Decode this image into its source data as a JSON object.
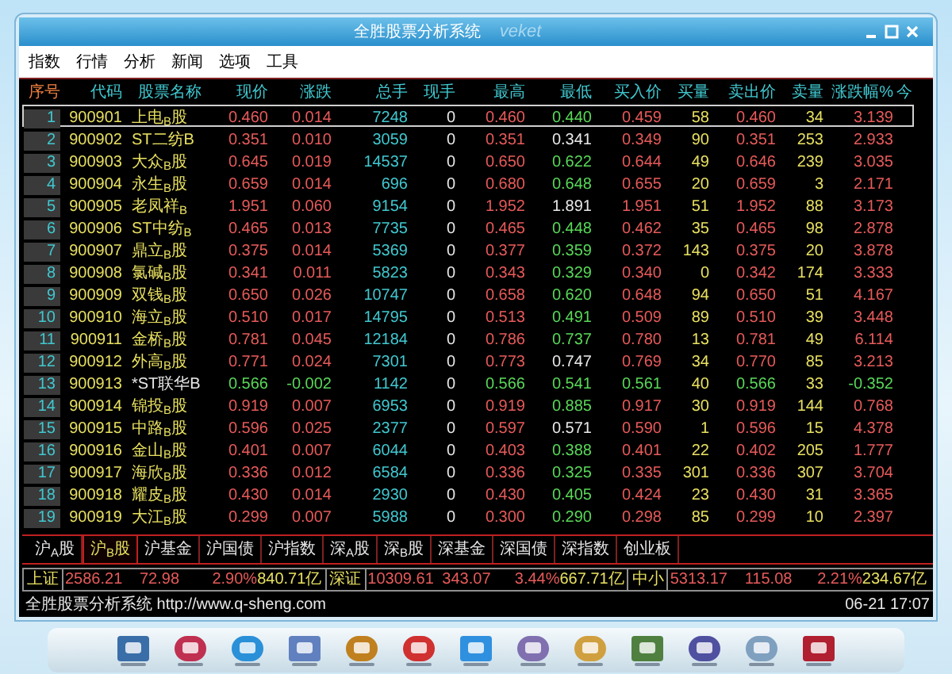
{
  "window": {
    "title": "全胜股票分析系统",
    "brand": "veket"
  },
  "menu": [
    "指数",
    "行情",
    "分析",
    "新闻",
    "选项",
    "工具"
  ],
  "table": {
    "columns": [
      {
        "label": "序号",
        "kind": "index"
      },
      {
        "label": "代码",
        "kind": "plain"
      },
      {
        "label": "股票名称",
        "kind": "plain"
      },
      {
        "label": "现价",
        "kind": "plain"
      },
      {
        "label": "涨跌",
        "kind": "plain"
      },
      {
        "label": "总手",
        "kind": "plain"
      },
      {
        "label": "现手",
        "kind": "plain"
      },
      {
        "label": "最高",
        "kind": "plain"
      },
      {
        "label": "最低",
        "kind": "plain"
      },
      {
        "label": "买入价",
        "kind": "plain"
      },
      {
        "label": "买量",
        "kind": "plain"
      },
      {
        "label": "卖出价",
        "kind": "plain"
      },
      {
        "label": "卖量",
        "kind": "plain"
      },
      {
        "label": "涨跌幅%",
        "kind": "plain"
      },
      {
        "label": "今",
        "kind": "plain"
      }
    ],
    "rows": [
      {
        "selected": true,
        "cells": [
          {
            "text": "1"
          },
          {
            "text": "900901",
            "color": "#e8e060"
          },
          {
            "text": "上电$_{B}$股",
            "color": "#e8e060"
          },
          {
            "text": "0.460",
            "color": "#e85a5a"
          },
          {
            "text": "0.014",
            "color": "#e85a5a"
          },
          {
            "text": "7248",
            "color": "#40c8d0"
          },
          {
            "text": "0",
            "color": "#e8e8e8"
          },
          {
            "text": "0.460",
            "color": "#e85a5a"
          },
          {
            "text": "0.440",
            "color": "#58d858"
          },
          {
            "text": "0.459",
            "color": "#e85a5a"
          },
          {
            "text": "58",
            "color": "#e8e060"
          },
          {
            "text": "0.460",
            "color": "#e85a5a"
          },
          {
            "text": "34",
            "color": "#e8e060"
          },
          {
            "text": "3.139",
            "color": "#e85a5a"
          }
        ]
      },
      {
        "selected": false,
        "cells": [
          {
            "text": "2"
          },
          {
            "text": "900902",
            "color": "#e8e060"
          },
          {
            "text": "ST二纺B",
            "color": "#e8e060"
          },
          {
            "text": "0.351",
            "color": "#e85a5a"
          },
          {
            "text": "0.010",
            "color": "#e85a5a"
          },
          {
            "text": "3059",
            "color": "#40c8d0"
          },
          {
            "text": "0",
            "color": "#e8e8e8"
          },
          {
            "text": "0.351",
            "color": "#e85a5a"
          },
          {
            "text": "0.341",
            "color": "#e8e8e8"
          },
          {
            "text": "0.349",
            "color": "#e85a5a"
          },
          {
            "text": "90",
            "color": "#e8e060"
          },
          {
            "text": "0.351",
            "color": "#e85a5a"
          },
          {
            "text": "253",
            "color": "#e8e060"
          },
          {
            "text": "2.933",
            "color": "#e85a5a"
          }
        ]
      },
      {
        "selected": false,
        "cells": [
          {
            "text": "3"
          },
          {
            "text": "900903",
            "color": "#e8e060"
          },
          {
            "text": "大众$_{B}$股",
            "color": "#e8e060"
          },
          {
            "text": "0.645",
            "color": "#e85a5a"
          },
          {
            "text": "0.019",
            "color": "#e85a5a"
          },
          {
            "text": "14537",
            "color": "#40c8d0"
          },
          {
            "text": "0",
            "color": "#e8e8e8"
          },
          {
            "text": "0.650",
            "color": "#e85a5a"
          },
          {
            "text": "0.622",
            "color": "#58d858"
          },
          {
            "text": "0.644",
            "color": "#e85a5a"
          },
          {
            "text": "49",
            "color": "#e8e060"
          },
          {
            "text": "0.646",
            "color": "#e85a5a"
          },
          {
            "text": "239",
            "color": "#e8e060"
          },
          {
            "text": "3.035",
            "color": "#e85a5a"
          }
        ]
      },
      {
        "selected": false,
        "cells": [
          {
            "text": "4"
          },
          {
            "text": "900904",
            "color": "#e8e060"
          },
          {
            "text": "永生$_{B}$股",
            "color": "#e8e060"
          },
          {
            "text": "0.659",
            "color": "#e85a5a"
          },
          {
            "text": "0.014",
            "color": "#e85a5a"
          },
          {
            "text": "696",
            "color": "#40c8d0"
          },
          {
            "text": "0",
            "color": "#e8e8e8"
          },
          {
            "text": "0.680",
            "color": "#e85a5a"
          },
          {
            "text": "0.648",
            "color": "#58d858"
          },
          {
            "text": "0.655",
            "color": "#e85a5a"
          },
          {
            "text": "20",
            "color": "#e8e060"
          },
          {
            "text": "0.659",
            "color": "#e85a5a"
          },
          {
            "text": "3",
            "color": "#e8e060"
          },
          {
            "text": "2.171",
            "color": "#e85a5a"
          }
        ]
      },
      {
        "selected": false,
        "cells": [
          {
            "text": "5"
          },
          {
            "text": "900905",
            "color": "#e8e060"
          },
          {
            "text": "老凤祥$_{B}$",
            "color": "#e8e060"
          },
          {
            "text": "1.951",
            "color": "#e85a5a"
          },
          {
            "text": "0.060",
            "color": "#e85a5a"
          },
          {
            "text": "9154",
            "color": "#40c8d0"
          },
          {
            "text": "0",
            "color": "#e8e8e8"
          },
          {
            "text": "1.952",
            "color": "#e85a5a"
          },
          {
            "text": "1.891",
            "color": "#e8e8e8"
          },
          {
            "text": "1.951",
            "color": "#e85a5a"
          },
          {
            "text": "51",
            "color": "#e8e060"
          },
          {
            "text": "1.952",
            "color": "#e85a5a"
          },
          {
            "text": "88",
            "color": "#e8e060"
          },
          {
            "text": "3.173",
            "color": "#e85a5a"
          }
        ]
      },
      {
        "selected": false,
        "cells": [
          {
            "text": "6"
          },
          {
            "text": "900906",
            "color": "#e8e060"
          },
          {
            "text": "ST中纺$_{B}$",
            "color": "#e8e060"
          },
          {
            "text": "0.465",
            "color": "#e85a5a"
          },
          {
            "text": "0.013",
            "color": "#e85a5a"
          },
          {
            "text": "7735",
            "color": "#40c8d0"
          },
          {
            "text": "0",
            "color": "#e8e8e8"
          },
          {
            "text": "0.465",
            "color": "#e85a5a"
          },
          {
            "text": "0.448",
            "color": "#58d858"
          },
          {
            "text": "0.462",
            "color": "#e85a5a"
          },
          {
            "text": "35",
            "color": "#e8e060"
          },
          {
            "text": "0.465",
            "color": "#e85a5a"
          },
          {
            "text": "98",
            "color": "#e8e060"
          },
          {
            "text": "2.878",
            "color": "#e85a5a"
          }
        ]
      },
      {
        "selected": false,
        "cells": [
          {
            "text": "7"
          },
          {
            "text": "900907",
            "color": "#e8e060"
          },
          {
            "text": "鼎立$_{B}$股",
            "color": "#e8e060"
          },
          {
            "text": "0.375",
            "color": "#e85a5a"
          },
          {
            "text": "0.014",
            "color": "#e85a5a"
          },
          {
            "text": "5369",
            "color": "#40c8d0"
          },
          {
            "text": "0",
            "color": "#e8e8e8"
          },
          {
            "text": "0.377",
            "color": "#e85a5a"
          },
          {
            "text": "0.359",
            "color": "#58d858"
          },
          {
            "text": "0.372",
            "color": "#e85a5a"
          },
          {
            "text": "143",
            "color": "#e8e060"
          },
          {
            "text": "0.375",
            "color": "#e85a5a"
          },
          {
            "text": "20",
            "color": "#e8e060"
          },
          {
            "text": "3.878",
            "color": "#e85a5a"
          }
        ]
      },
      {
        "selected": false,
        "cells": [
          {
            "text": "8"
          },
          {
            "text": "900908",
            "color": "#e8e060"
          },
          {
            "text": "氯碱$_{B}$股",
            "color": "#e8e060"
          },
          {
            "text": "0.341",
            "color": "#e85a5a"
          },
          {
            "text": "0.011",
            "color": "#e85a5a"
          },
          {
            "text": "5823",
            "color": "#40c8d0"
          },
          {
            "text": "0",
            "color": "#e8e8e8"
          },
          {
            "text": "0.343",
            "color": "#e85a5a"
          },
          {
            "text": "0.329",
            "color": "#58d858"
          },
          {
            "text": "0.340",
            "color": "#e85a5a"
          },
          {
            "text": "0",
            "color": "#e8e060"
          },
          {
            "text": "0.342",
            "color": "#e85a5a"
          },
          {
            "text": "174",
            "color": "#e8e060"
          },
          {
            "text": "3.333",
            "color": "#e85a5a"
          }
        ]
      },
      {
        "selected": false,
        "cells": [
          {
            "text": "9"
          },
          {
            "text": "900909",
            "color": "#e8e060"
          },
          {
            "text": "双钱$_{B}$股",
            "color": "#e8e060"
          },
          {
            "text": "0.650",
            "color": "#e85a5a"
          },
          {
            "text": "0.026",
            "color": "#e85a5a"
          },
          {
            "text": "10747",
            "color": "#40c8d0"
          },
          {
            "text": "0",
            "color": "#e8e8e8"
          },
          {
            "text": "0.658",
            "color": "#e85a5a"
          },
          {
            "text": "0.620",
            "color": "#58d858"
          },
          {
            "text": "0.648",
            "color": "#e85a5a"
          },
          {
            "text": "94",
            "color": "#e8e060"
          },
          {
            "text": "0.650",
            "color": "#e85a5a"
          },
          {
            "text": "51",
            "color": "#e8e060"
          },
          {
            "text": "4.167",
            "color": "#e85a5a"
          }
        ]
      },
      {
        "selected": false,
        "cells": [
          {
            "text": "10"
          },
          {
            "text": "900910",
            "color": "#e8e060"
          },
          {
            "text": "海立$_{B}$股",
            "color": "#e8e060"
          },
          {
            "text": "0.510",
            "color": "#e85a5a"
          },
          {
            "text": "0.017",
            "color": "#e85a5a"
          },
          {
            "text": "14795",
            "color": "#40c8d0"
          },
          {
            "text": "0",
            "color": "#e8e8e8"
          },
          {
            "text": "0.513",
            "color": "#e85a5a"
          },
          {
            "text": "0.491",
            "color": "#58d858"
          },
          {
            "text": "0.509",
            "color": "#e85a5a"
          },
          {
            "text": "89",
            "color": "#e8e060"
          },
          {
            "text": "0.510",
            "color": "#e85a5a"
          },
          {
            "text": "39",
            "color": "#e8e060"
          },
          {
            "text": "3.448",
            "color": "#e85a5a"
          }
        ]
      },
      {
        "selected": false,
        "cells": [
          {
            "text": "11"
          },
          {
            "text": "900911",
            "color": "#e8e060"
          },
          {
            "text": "金桥$_{B}$股",
            "color": "#e8e060"
          },
          {
            "text": "0.781",
            "color": "#e85a5a"
          },
          {
            "text": "0.045",
            "color": "#e85a5a"
          },
          {
            "text": "12184",
            "color": "#40c8d0"
          },
          {
            "text": "0",
            "color": "#e8e8e8"
          },
          {
            "text": "0.786",
            "color": "#e85a5a"
          },
          {
            "text": "0.737",
            "color": "#58d858"
          },
          {
            "text": "0.780",
            "color": "#e85a5a"
          },
          {
            "text": "13",
            "color": "#e8e060"
          },
          {
            "text": "0.781",
            "color": "#e85a5a"
          },
          {
            "text": "49",
            "color": "#e8e060"
          },
          {
            "text": "6.114",
            "color": "#e85a5a"
          }
        ]
      },
      {
        "selected": false,
        "cells": [
          {
            "text": "12"
          },
          {
            "text": "900912",
            "color": "#e8e060"
          },
          {
            "text": "外高$_{B}$股",
            "color": "#e8e060"
          },
          {
            "text": "0.771",
            "color": "#e85a5a"
          },
          {
            "text": "0.024",
            "color": "#e85a5a"
          },
          {
            "text": "7301",
            "color": "#40c8d0"
          },
          {
            "text": "0",
            "color": "#e8e8e8"
          },
          {
            "text": "0.773",
            "color": "#e85a5a"
          },
          {
            "text": "0.747",
            "color": "#e8e8e8"
          },
          {
            "text": "0.769",
            "color": "#e85a5a"
          },
          {
            "text": "34",
            "color": "#e8e060"
          },
          {
            "text": "0.770",
            "color": "#e85a5a"
          },
          {
            "text": "85",
            "color": "#e8e060"
          },
          {
            "text": "3.213",
            "color": "#e85a5a"
          }
        ]
      },
      {
        "selected": false,
        "cells": [
          {
            "text": "13"
          },
          {
            "text": "900913",
            "color": "#e8e060"
          },
          {
            "text": "*ST联华B",
            "color": "#e8e8e8"
          },
          {
            "text": "0.566",
            "color": "#58d858"
          },
          {
            "text": "-0.002",
            "color": "#58d858"
          },
          {
            "text": "1142",
            "color": "#40c8d0"
          },
          {
            "text": "0",
            "color": "#e8e8e8"
          },
          {
            "text": "0.566",
            "color": "#58d858"
          },
          {
            "text": "0.541",
            "color": "#58d858"
          },
          {
            "text": "0.561",
            "color": "#58d858"
          },
          {
            "text": "40",
            "color": "#e8e060"
          },
          {
            "text": "0.566",
            "color": "#58d858"
          },
          {
            "text": "33",
            "color": "#e8e060"
          },
          {
            "text": "-0.352",
            "color": "#58d858"
          }
        ]
      },
      {
        "selected": false,
        "cells": [
          {
            "text": "14"
          },
          {
            "text": "900914",
            "color": "#e8e060"
          },
          {
            "text": "锦投$_{B}$股",
            "color": "#e8e060"
          },
          {
            "text": "0.919",
            "color": "#e85a5a"
          },
          {
            "text": "0.007",
            "color": "#e85a5a"
          },
          {
            "text": "6953",
            "color": "#40c8d0"
          },
          {
            "text": "0",
            "color": "#e8e8e8"
          },
          {
            "text": "0.919",
            "color": "#e85a5a"
          },
          {
            "text": "0.885",
            "color": "#58d858"
          },
          {
            "text": "0.917",
            "color": "#e85a5a"
          },
          {
            "text": "30",
            "color": "#e8e060"
          },
          {
            "text": "0.919",
            "color": "#e85a5a"
          },
          {
            "text": "144",
            "color": "#e8e060"
          },
          {
            "text": "0.768",
            "color": "#e85a5a"
          }
        ]
      },
      {
        "selected": false,
        "cells": [
          {
            "text": "15"
          },
          {
            "text": "900915",
            "color": "#e8e060"
          },
          {
            "text": "中路$_{B}$股",
            "color": "#e8e060"
          },
          {
            "text": "0.596",
            "color": "#e85a5a"
          },
          {
            "text": "0.025",
            "color": "#e85a5a"
          },
          {
            "text": "2377",
            "color": "#40c8d0"
          },
          {
            "text": "0",
            "color": "#e8e8e8"
          },
          {
            "text": "0.597",
            "color": "#e85a5a"
          },
          {
            "text": "0.571",
            "color": "#e8e8e8"
          },
          {
            "text": "0.590",
            "color": "#e85a5a"
          },
          {
            "text": "1",
            "color": "#e8e060"
          },
          {
            "text": "0.596",
            "color": "#e85a5a"
          },
          {
            "text": "15",
            "color": "#e8e060"
          },
          {
            "text": "4.378",
            "color": "#e85a5a"
          }
        ]
      },
      {
        "selected": false,
        "cells": [
          {
            "text": "16"
          },
          {
            "text": "900916",
            "color": "#e8e060"
          },
          {
            "text": "金山$_{B}$股",
            "color": "#e8e060"
          },
          {
            "text": "0.401",
            "color": "#e85a5a"
          },
          {
            "text": "0.007",
            "color": "#e85a5a"
          },
          {
            "text": "6044",
            "color": "#40c8d0"
          },
          {
            "text": "0",
            "color": "#e8e8e8"
          },
          {
            "text": "0.403",
            "color": "#e85a5a"
          },
          {
            "text": "0.388",
            "color": "#58d858"
          },
          {
            "text": "0.401",
            "color": "#e85a5a"
          },
          {
            "text": "22",
            "color": "#e8e060"
          },
          {
            "text": "0.402",
            "color": "#e85a5a"
          },
          {
            "text": "205",
            "color": "#e8e060"
          },
          {
            "text": "1.777",
            "color": "#e85a5a"
          }
        ]
      },
      {
        "selected": false,
        "cells": [
          {
            "text": "17"
          },
          {
            "text": "900917",
            "color": "#e8e060"
          },
          {
            "text": "海欣$_{B}$股",
            "color": "#e8e060"
          },
          {
            "text": "0.336",
            "color": "#e85a5a"
          },
          {
            "text": "0.012",
            "color": "#e85a5a"
          },
          {
            "text": "6584",
            "color": "#40c8d0"
          },
          {
            "text": "0",
            "color": "#e8e8e8"
          },
          {
            "text": "0.336",
            "color": "#e85a5a"
          },
          {
            "text": "0.325",
            "color": "#58d858"
          },
          {
            "text": "0.335",
            "color": "#e85a5a"
          },
          {
            "text": "301",
            "color": "#e8e060"
          },
          {
            "text": "0.336",
            "color": "#e85a5a"
          },
          {
            "text": "307",
            "color": "#e8e060"
          },
          {
            "text": "3.704",
            "color": "#e85a5a"
          }
        ]
      },
      {
        "selected": false,
        "cells": [
          {
            "text": "18"
          },
          {
            "text": "900918",
            "color": "#e8e060"
          },
          {
            "text": "耀皮$_{B}$股",
            "color": "#e8e060"
          },
          {
            "text": "0.430",
            "color": "#e85a5a"
          },
          {
            "text": "0.014",
            "color": "#e85a5a"
          },
          {
            "text": "2930",
            "color": "#40c8d0"
          },
          {
            "text": "0",
            "color": "#e8e8e8"
          },
          {
            "text": "0.430",
            "color": "#e85a5a"
          },
          {
            "text": "0.405",
            "color": "#58d858"
          },
          {
            "text": "0.424",
            "color": "#e85a5a"
          },
          {
            "text": "23",
            "color": "#e8e060"
          },
          {
            "text": "0.430",
            "color": "#e85a5a"
          },
          {
            "text": "31",
            "color": "#e8e060"
          },
          {
            "text": "3.365",
            "color": "#e85a5a"
          }
        ]
      },
      {
        "selected": false,
        "cells": [
          {
            "text": "19"
          },
          {
            "text": "900919",
            "color": "#e8e060"
          },
          {
            "text": "大江$_{B}$股",
            "color": "#e8e060"
          },
          {
            "text": "0.299",
            "color": "#e85a5a"
          },
          {
            "text": "0.007",
            "color": "#e85a5a"
          },
          {
            "text": "5988",
            "color": "#40c8d0"
          },
          {
            "text": "0",
            "color": "#e8e8e8"
          },
          {
            "text": "0.300",
            "color": "#e85a5a"
          },
          {
            "text": "0.290",
            "color": "#58d858"
          },
          {
            "text": "0.298",
            "color": "#e85a5a"
          },
          {
            "text": "85",
            "color": "#e8e060"
          },
          {
            "text": "0.299",
            "color": "#e85a5a"
          },
          {
            "text": "10",
            "color": "#e8e060"
          },
          {
            "text": "2.397",
            "color": "#e85a5a"
          }
        ]
      }
    ]
  },
  "market_tabs": [
    {
      "label": "沪$_{A}$股",
      "selected": false
    },
    {
      "label": "沪$_{B}$股",
      "selected": true
    },
    {
      "label": "沪基金",
      "selected": false
    },
    {
      "label": "沪国债",
      "selected": false
    },
    {
      "label": "沪指数",
      "selected": false
    },
    {
      "label": "深$_{A}$股",
      "selected": false
    },
    {
      "label": "深$_{B}$股",
      "selected": false
    },
    {
      "label": "深基金",
      "selected": false
    },
    {
      "label": "深国债",
      "selected": false
    },
    {
      "label": "深指数",
      "selected": false
    },
    {
      "label": "创业板",
      "selected": false
    }
  ],
  "indices": [
    {
      "label": "上证",
      "index": "2586.21",
      "change": "72.98",
      "pct": "2.90%",
      "amount": "840.71亿"
    },
    {
      "label": "深证",
      "index": "10309.61",
      "change": "343.07",
      "pct": "3.44%",
      "amount": "667.71亿"
    },
    {
      "label": "中小",
      "index": "5313.17",
      "change": "115.08",
      "pct": "2.21%",
      "amount": "234.67亿"
    }
  ],
  "status_bar": {
    "text": "全胜股票分析系统 http://www.q-sheng.com",
    "time": "06-21 17:07"
  }
}
